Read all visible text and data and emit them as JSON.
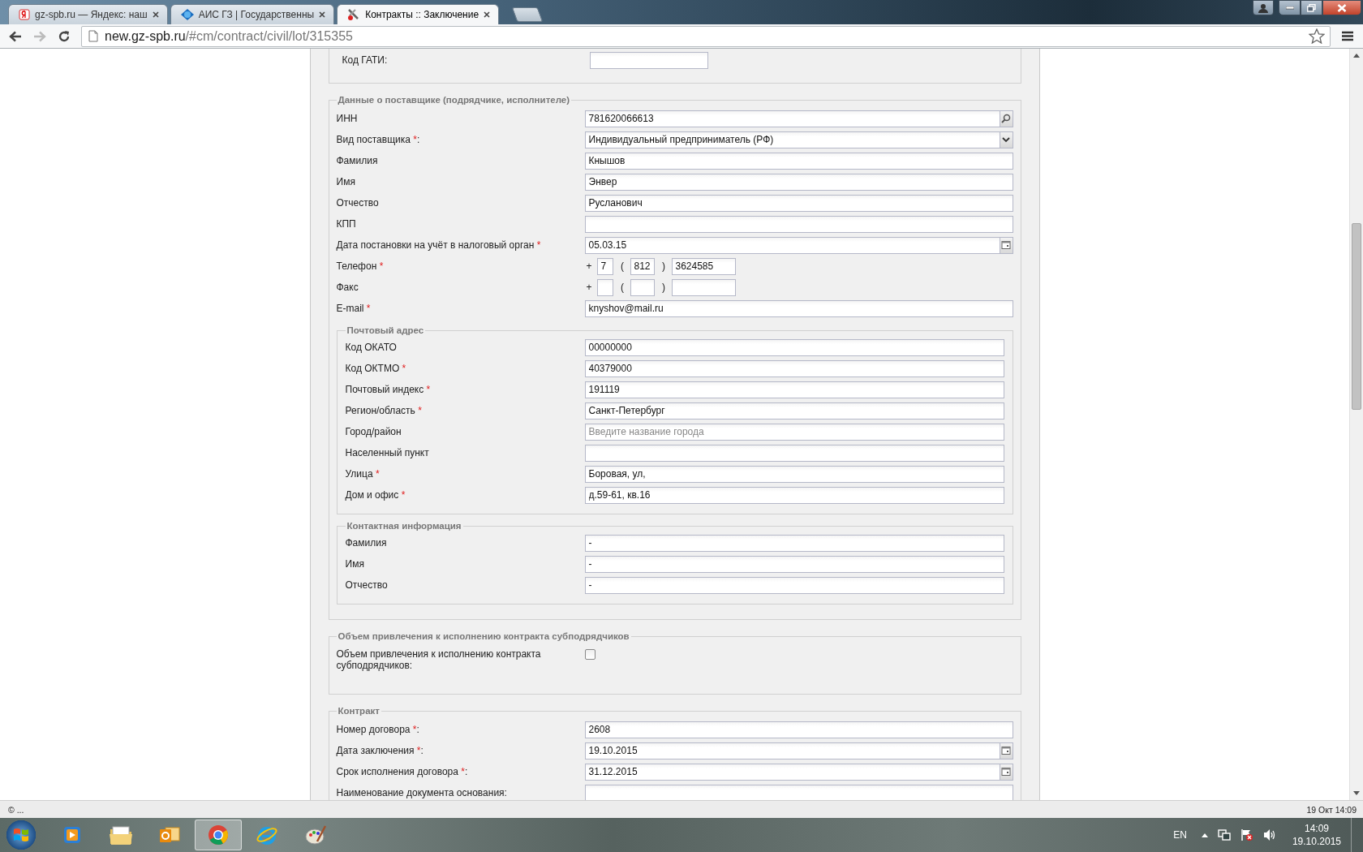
{
  "browser": {
    "tabs": [
      {
        "title": "gz-spb.ru — Яндекс: наш",
        "selected": false
      },
      {
        "title": "АИС ГЗ | Государственны",
        "selected": false
      },
      {
        "title": "Контракты :: Заключение",
        "selected": true
      }
    ],
    "url_host": "new.gz-spb.ru",
    "url_path": "/#cm/contract/civil/lot/315355"
  },
  "form": {
    "top_rows": [
      {
        "kind": "text",
        "label": "Код ГАТИ:"
      }
    ],
    "sections": [
      {
        "legend": "Данные о поставщике (подрядчике, исполнителе)",
        "rows": [
          {
            "kind": "search",
            "label": "ИНН",
            "value": "781620066613"
          },
          {
            "kind": "select",
            "label": "Вид поставщика",
            "required_mark": "*",
            "suffix": ":",
            "value": "Индивидуальный предприниматель (РФ)"
          },
          {
            "kind": "text",
            "label": "Фамилия",
            "value": "Кнышов"
          },
          {
            "kind": "text",
            "label": "Имя",
            "value": "Энвер"
          },
          {
            "kind": "text",
            "label": "Отчество",
            "value": "Русланович"
          },
          {
            "kind": "text",
            "label": "КПП"
          },
          {
            "kind": "date",
            "label": "Дата постановки на учёт в налоговый орган",
            "required_mark": "*",
            "value": "05.03.15"
          },
          {
            "kind": "phone",
            "label": "Телефон",
            "required_mark": "*",
            "plus": "+",
            "lparen": "(",
            "rparen": ")",
            "country": "7",
            "area": "812",
            "number": "3624585"
          },
          {
            "kind": "phone",
            "label": "Факс",
            "plus": "+",
            "lparen": "(",
            "rparen": ")"
          },
          {
            "kind": "text",
            "label": "E-mail",
            "required_mark": "*",
            "value": "knyshov@mail.ru"
          }
        ],
        "groups": [
          {
            "legend": "Почтовый адрес",
            "rows": [
              {
                "kind": "text",
                "label": "Код ОКАТО",
                "value": "00000000"
              },
              {
                "kind": "text",
                "label": "Код ОКТМО",
                "required_mark": "*",
                "value": "40379000"
              },
              {
                "kind": "text",
                "label": "Почтовый индекс",
                "required_mark": "*",
                "value": "191119"
              },
              {
                "kind": "text",
                "label": "Регион/область",
                "required_mark": "*",
                "value": "Санкт-Петербург"
              },
              {
                "kind": "text",
                "label": "Город/район",
                "placeholder": "Введите название города"
              },
              {
                "kind": "text",
                "label": "Населенный пункт"
              },
              {
                "kind": "text",
                "label": "Улица",
                "required_mark": "*",
                "value": "Боровая, ул,"
              },
              {
                "kind": "text",
                "label": "Дом и офис",
                "required_mark": "*",
                "value": "д.59-61, кв.16"
              }
            ]
          },
          {
            "legend": "Контактная информация",
            "rows": [
              {
                "kind": "text",
                "label": "Фамилия",
                "value": "-"
              },
              {
                "kind": "text",
                "label": "Имя",
                "value": "-"
              },
              {
                "kind": "text",
                "label": "Отчество",
                "value": "-"
              }
            ]
          }
        ]
      },
      {
        "legend": "Объем привлечения к исполнению контракта субподрядчиков",
        "rows": [
          {
            "kind": "checkbox",
            "label": "Объем привлечения к исполнению контракта субподрядчиков:",
            "checked": false
          }
        ]
      },
      {
        "legend": "Контракт",
        "rows": [
          {
            "kind": "text",
            "label": "Номер договора",
            "required_mark": "*",
            "suffix": ":",
            "value": "2608"
          },
          {
            "kind": "date",
            "label": "Дата заключения",
            "required_mark": "*",
            "suffix": ":",
            "value": "19.10.2015"
          },
          {
            "kind": "date",
            "label": "Срок исполнения договора",
            "required_mark": "*",
            "suffix": ":",
            "value": "31.12.2015"
          },
          {
            "kind": "text",
            "label": "Наименование документа основания:"
          }
        ]
      }
    ]
  },
  "status": {
    "text": "© ...",
    "datetime": "19 Окт 14:09"
  },
  "taskbar": {
    "apps": [
      {
        "kind": "media",
        "selected": false
      },
      {
        "kind": "folder",
        "selected": false
      },
      {
        "kind": "mail",
        "selected": false
      },
      {
        "kind": "chrome",
        "selected": true
      },
      {
        "kind": "ie",
        "selected": false
      },
      {
        "kind": "paint",
        "selected": false
      }
    ],
    "tray": {
      "language": "EN",
      "time": "14:09",
      "date": "19.10.2015"
    }
  }
}
